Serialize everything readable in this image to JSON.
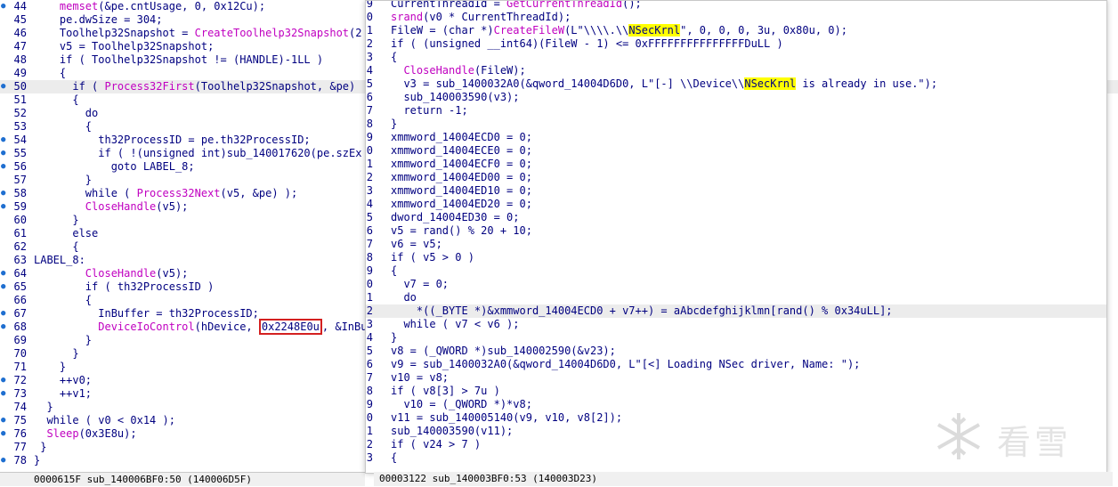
{
  "left": {
    "status": "0000615F sub_140006BF0:50 (140006D5F)",
    "lines": [
      {
        "n": "44",
        "bp": true,
        "t": "    memset(&pe.cntUsage, 0, 0x12Cu);"
      },
      {
        "n": "45",
        "bp": false,
        "t": "    pe.dwSize = 304;"
      },
      {
        "n": "46",
        "bp": false,
        "t": "    Toolhelp32Snapshot = CreateToolhelp32Snapshot(2"
      },
      {
        "n": "47",
        "bp": false,
        "t": "    v5 = Toolhelp32Snapshot;"
      },
      {
        "n": "48",
        "bp": false,
        "t": "    if ( Toolhelp32Snapshot != (HANDLE)-1LL )"
      },
      {
        "n": "49",
        "bp": false,
        "t": "    {"
      },
      {
        "n": "50",
        "bp": true,
        "t": "      if ( Process32First(Toolhelp32Snapshot, &pe) "
      },
      {
        "n": "51",
        "bp": false,
        "t": "      {"
      },
      {
        "n": "52",
        "bp": false,
        "t": "        do"
      },
      {
        "n": "53",
        "bp": false,
        "t": "        {"
      },
      {
        "n": "54",
        "bp": true,
        "t": "          th32ProcessID = pe.th32ProcessID;"
      },
      {
        "n": "55",
        "bp": true,
        "t": "          if ( !(unsigned int)sub_140017620(pe.szEx"
      },
      {
        "n": "56",
        "bp": true,
        "t": "            goto LABEL_8;"
      },
      {
        "n": "57",
        "bp": false,
        "t": "        }"
      },
      {
        "n": "58",
        "bp": true,
        "t": "        while ( Process32Next(v5, &pe) );"
      },
      {
        "n": "59",
        "bp": true,
        "t": "        CloseHandle(v5);"
      },
      {
        "n": "60",
        "bp": false,
        "t": "      }"
      },
      {
        "n": "61",
        "bp": false,
        "t": "      else"
      },
      {
        "n": "62",
        "bp": false,
        "t": "      {"
      },
      {
        "n": "63",
        "bp": false,
        "t": "LABEL_8:"
      },
      {
        "n": "64",
        "bp": true,
        "t": "        CloseHandle(v5);"
      },
      {
        "n": "65",
        "bp": true,
        "t": "        if ( th32ProcessID )"
      },
      {
        "n": "66",
        "bp": false,
        "t": "        {"
      },
      {
        "n": "67",
        "bp": true,
        "t": "          InBuffer = th32ProcessID;"
      },
      {
        "n": "68",
        "bp": true,
        "t": "          DeviceIoControl(hDevice, 0x2248E0u, &InBu"
      },
      {
        "n": "69",
        "bp": false,
        "t": "        }"
      },
      {
        "n": "70",
        "bp": false,
        "t": "      }"
      },
      {
        "n": "71",
        "bp": false,
        "t": "    }"
      },
      {
        "n": "72",
        "bp": true,
        "t": "    ++v0;"
      },
      {
        "n": "73",
        "bp": true,
        "t": "    ++v1;"
      },
      {
        "n": "74",
        "bp": false,
        "t": "  }"
      },
      {
        "n": "75",
        "bp": true,
        "t": "  while ( v0 < 0x14 );"
      },
      {
        "n": "76",
        "bp": true,
        "t": "  Sleep(0x3E8u);"
      },
      {
        "n": "77",
        "bp": false,
        "t": " }"
      },
      {
        "n": "78",
        "bp": true,
        "t": "}"
      }
    ]
  },
  "right": {
    "status": "00003122 sub_140003BF0:53 (140003D23)",
    "lines": [
      {
        "n": "9",
        "t": "CurrentThreadId = GetCurrentThreadId();"
      },
      {
        "n": "0",
        "t": "srand(v0 * CurrentThreadId);"
      },
      {
        "n": "1",
        "t": "FileW = (char *)CreateFileW(L\"\\\\\\\\.\\\\NSecKrnl\", 0, 0, 0, 3u, 0x80u, 0);"
      },
      {
        "n": "2",
        "t": "if ( (unsigned __int64)(FileW - 1) <= 0xFFFFFFFFFFFFFFFDuLL )"
      },
      {
        "n": "3",
        "t": "{"
      },
      {
        "n": "4",
        "t": "  CloseHandle(FileW);"
      },
      {
        "n": "5",
        "t": "  v3 = sub_1400032A0(&qword_14004D6D0, L\"[-] \\\\Device\\\\NSecKrnl is already in use.\");"
      },
      {
        "n": "6",
        "t": "  sub_140003590(v3);"
      },
      {
        "n": "7",
        "t": "  return -1;"
      },
      {
        "n": "8",
        "t": "}"
      },
      {
        "n": "9",
        "t": "xmmword_14004ECD0 = 0;"
      },
      {
        "n": "0",
        "t": "xmmword_14004ECE0 = 0;"
      },
      {
        "n": "1",
        "t": "xmmword_14004ECF0 = 0;"
      },
      {
        "n": "2",
        "t": "xmmword_14004ED00 = 0;"
      },
      {
        "n": "3",
        "t": "xmmword_14004ED10 = 0;"
      },
      {
        "n": "4",
        "t": "xmmword_14004ED20 = 0;"
      },
      {
        "n": "5",
        "t": "dword_14004ED30 = 0;"
      },
      {
        "n": "6",
        "t": "v5 = rand() % 20 + 10;"
      },
      {
        "n": "7",
        "t": "v6 = v5;"
      },
      {
        "n": "8",
        "t": "if ( v5 > 0 )"
      },
      {
        "n": "9",
        "t": "{"
      },
      {
        "n": "0",
        "t": "  v7 = 0;"
      },
      {
        "n": "1",
        "t": "  do"
      },
      {
        "n": "2",
        "t": "    *((_BYTE *)&xmmword_14004ECD0 + v7++) = aAbcdefghijklmn[rand() % 0x34uLL];"
      },
      {
        "n": "3",
        "t": "  while ( v7 < v6 );"
      },
      {
        "n": "4",
        "t": "}"
      },
      {
        "n": "5",
        "t": "v8 = (_QWORD *)sub_140002590(&v23);"
      },
      {
        "n": "6",
        "t": "v9 = sub_1400032A0(&qword_14004D6D0, L\"[<] Loading NSec driver, Name: \");"
      },
      {
        "n": "7",
        "t": "v10 = v8;"
      },
      {
        "n": "8",
        "t": "if ( v8[3] > 7u )"
      },
      {
        "n": "9",
        "t": "  v10 = (_QWORD *)*v8;"
      },
      {
        "n": "0",
        "t": "v11 = sub_140005140(v9, v10, v8[2]);"
      },
      {
        "n": "1",
        "t": "sub_140003590(v11);"
      },
      {
        "n": "2",
        "t": "if ( v24 > 7 )"
      },
      {
        "n": "3",
        "t": "{"
      }
    ]
  },
  "watermark": "看雪"
}
